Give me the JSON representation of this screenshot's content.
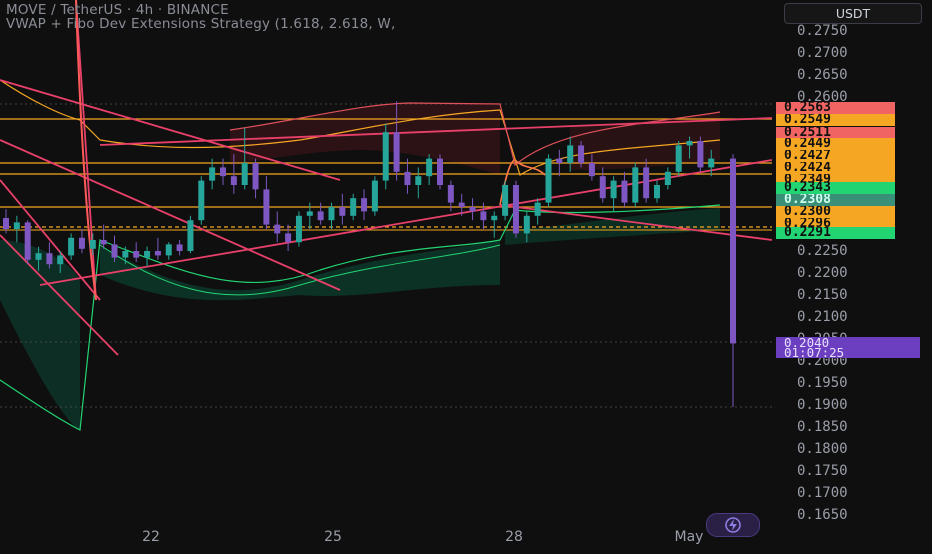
{
  "header": {
    "symbol_line": "MOVE / TetherUS · 4h · BINANCE",
    "indicator_line": "VWAP + Fibo Dev Extensions Strategy (1.618, 2.618, W,"
  },
  "price_axis": {
    "currency_button": "USDT",
    "ticks": [
      "0.2750",
      "0.2700",
      "0.2650",
      "0.2600",
      "0.2550",
      "0.2500",
      "0.2450",
      "0.2400",
      "0.2350",
      "0.2300",
      "0.2250",
      "0.2200",
      "0.2150",
      "0.2100",
      "0.2050",
      "0.2000",
      "0.1950",
      "0.1900",
      "0.1850",
      "0.1800",
      "0.1750",
      "0.1700",
      "0.1650"
    ]
  },
  "level_badges": [
    {
      "label": "0.2563",
      "color": "#f06463"
    },
    {
      "label": "0.2549",
      "color": "#f5a623"
    },
    {
      "label": "0.2511",
      "color": "#f06463"
    },
    {
      "label": "0.2449",
      "color": "#f5a623"
    },
    {
      "label": "0.2427",
      "color": "#f5a623"
    },
    {
      "label": "0.2424",
      "color": "#f5a623"
    },
    {
      "label": "0.2349",
      "color": "#f5a623"
    },
    {
      "label": "0.2343",
      "color": "#22d572"
    },
    {
      "label": "0.2308",
      "color": "#3a8f78"
    },
    {
      "label": "0.2300",
      "color": "#f5a623"
    },
    {
      "label": "0.2296",
      "color": "#f5a623"
    },
    {
      "label": "0.2291",
      "color": "#22d572"
    }
  ],
  "current_price": {
    "price": "0.2040",
    "countdown": "01:07:25",
    "color": "#6b3fbf"
  },
  "time_axis": [
    "22",
    "25",
    "28",
    "May"
  ],
  "chart_data": {
    "type": "candlestick",
    "title": "MOVE / TetherUS · 4h · BINANCE",
    "ylim": [
      0.1635,
      0.2785
    ],
    "x": [
      "22",
      "25",
      "28",
      "May"
    ],
    "series": [
      {
        "name": "candles",
        "values": [
          {
            "o": 0.2325,
            "h": 0.2345,
            "l": 0.229,
            "c": 0.23
          },
          {
            "o": 0.23,
            "h": 0.233,
            "l": 0.227,
            "c": 0.2315
          },
          {
            "o": 0.2315,
            "h": 0.232,
            "l": 0.222,
            "c": 0.223
          },
          {
            "o": 0.223,
            "h": 0.226,
            "l": 0.2205,
            "c": 0.2245
          },
          {
            "o": 0.2245,
            "h": 0.227,
            "l": 0.221,
            "c": 0.222
          },
          {
            "o": 0.222,
            "h": 0.225,
            "l": 0.22,
            "c": 0.224
          },
          {
            "o": 0.224,
            "h": 0.229,
            "l": 0.223,
            "c": 0.228
          },
          {
            "o": 0.228,
            "h": 0.23,
            "l": 0.2245,
            "c": 0.2255
          },
          {
            "o": 0.2255,
            "h": 0.229,
            "l": 0.224,
            "c": 0.2275
          },
          {
            "o": 0.2275,
            "h": 0.231,
            "l": 0.2255,
            "c": 0.2265
          },
          {
            "o": 0.2265,
            "h": 0.2285,
            "l": 0.2225,
            "c": 0.2235
          },
          {
            "o": 0.2235,
            "h": 0.226,
            "l": 0.222,
            "c": 0.225
          },
          {
            "o": 0.225,
            "h": 0.227,
            "l": 0.2225,
            "c": 0.2235
          },
          {
            "o": 0.2235,
            "h": 0.226,
            "l": 0.2215,
            "c": 0.225
          },
          {
            "o": 0.225,
            "h": 0.228,
            "l": 0.223,
            "c": 0.224
          },
          {
            "o": 0.224,
            "h": 0.227,
            "l": 0.223,
            "c": 0.2265
          },
          {
            "o": 0.2265,
            "h": 0.2275,
            "l": 0.224,
            "c": 0.225
          },
          {
            "o": 0.225,
            "h": 0.233,
            "l": 0.2245,
            "c": 0.232
          },
          {
            "o": 0.232,
            "h": 0.242,
            "l": 0.231,
            "c": 0.241
          },
          {
            "o": 0.241,
            "h": 0.246,
            "l": 0.239,
            "c": 0.244
          },
          {
            "o": 0.244,
            "h": 0.246,
            "l": 0.24,
            "c": 0.242
          },
          {
            "o": 0.242,
            "h": 0.247,
            "l": 0.238,
            "c": 0.24
          },
          {
            "o": 0.24,
            "h": 0.253,
            "l": 0.239,
            "c": 0.245
          },
          {
            "o": 0.245,
            "h": 0.246,
            "l": 0.237,
            "c": 0.239
          },
          {
            "o": 0.239,
            "h": 0.242,
            "l": 0.23,
            "c": 0.231
          },
          {
            "o": 0.231,
            "h": 0.234,
            "l": 0.227,
            "c": 0.229
          },
          {
            "o": 0.229,
            "h": 0.231,
            "l": 0.225,
            "c": 0.227
          },
          {
            "o": 0.227,
            "h": 0.234,
            "l": 0.226,
            "c": 0.233
          },
          {
            "o": 0.233,
            "h": 0.236,
            "l": 0.23,
            "c": 0.234
          },
          {
            "o": 0.234,
            "h": 0.236,
            "l": 0.231,
            "c": 0.232
          },
          {
            "o": 0.232,
            "h": 0.236,
            "l": 0.23,
            "c": 0.235
          },
          {
            "o": 0.235,
            "h": 0.238,
            "l": 0.231,
            "c": 0.233
          },
          {
            "o": 0.233,
            "h": 0.238,
            "l": 0.232,
            "c": 0.237
          },
          {
            "o": 0.237,
            "h": 0.239,
            "l": 0.232,
            "c": 0.234
          },
          {
            "o": 0.234,
            "h": 0.242,
            "l": 0.233,
            "c": 0.241
          },
          {
            "o": 0.241,
            "h": 0.254,
            "l": 0.239,
            "c": 0.252
          },
          {
            "o": 0.252,
            "h": 0.259,
            "l": 0.241,
            "c": 0.243
          },
          {
            "o": 0.243,
            "h": 0.246,
            "l": 0.238,
            "c": 0.24
          },
          {
            "o": 0.24,
            "h": 0.244,
            "l": 0.237,
            "c": 0.242
          },
          {
            "o": 0.242,
            "h": 0.247,
            "l": 0.24,
            "c": 0.246
          },
          {
            "o": 0.246,
            "h": 0.247,
            "l": 0.239,
            "c": 0.24
          },
          {
            "o": 0.24,
            "h": 0.241,
            "l": 0.234,
            "c": 0.236
          },
          {
            "o": 0.236,
            "h": 0.238,
            "l": 0.233,
            "c": 0.235
          },
          {
            "o": 0.235,
            "h": 0.237,
            "l": 0.232,
            "c": 0.234
          },
          {
            "o": 0.234,
            "h": 0.236,
            "l": 0.23,
            "c": 0.232
          },
          {
            "o": 0.232,
            "h": 0.234,
            "l": 0.228,
            "c": 0.233
          },
          {
            "o": 0.233,
            "h": 0.241,
            "l": 0.232,
            "c": 0.24
          },
          {
            "o": 0.24,
            "h": 0.241,
            "l": 0.228,
            "c": 0.229
          },
          {
            "o": 0.229,
            "h": 0.234,
            "l": 0.227,
            "c": 0.233
          },
          {
            "o": 0.233,
            "h": 0.237,
            "l": 0.231,
            "c": 0.236
          },
          {
            "o": 0.236,
            "h": 0.247,
            "l": 0.235,
            "c": 0.246
          },
          {
            "o": 0.246,
            "h": 0.248,
            "l": 0.242,
            "c": 0.245
          },
          {
            "o": 0.245,
            "h": 0.251,
            "l": 0.243,
            "c": 0.249
          },
          {
            "o": 0.249,
            "h": 0.25,
            "l": 0.244,
            "c": 0.245
          },
          {
            "o": 0.245,
            "h": 0.247,
            "l": 0.241,
            "c": 0.242
          },
          {
            "o": 0.242,
            "h": 0.244,
            "l": 0.236,
            "c": 0.237
          },
          {
            "o": 0.237,
            "h": 0.242,
            "l": 0.234,
            "c": 0.241
          },
          {
            "o": 0.241,
            "h": 0.243,
            "l": 0.235,
            "c": 0.236
          },
          {
            "o": 0.236,
            "h": 0.245,
            "l": 0.235,
            "c": 0.244
          },
          {
            "o": 0.244,
            "h": 0.246,
            "l": 0.236,
            "c": 0.237
          },
          {
            "o": 0.237,
            "h": 0.241,
            "l": 0.236,
            "c": 0.24
          },
          {
            "o": 0.24,
            "h": 0.244,
            "l": 0.239,
            "c": 0.243
          },
          {
            "o": 0.243,
            "h": 0.25,
            "l": 0.242,
            "c": 0.249
          },
          {
            "o": 0.249,
            "h": 0.251,
            "l": 0.246,
            "c": 0.25
          },
          {
            "o": 0.25,
            "h": 0.251,
            "l": 0.243,
            "c": 0.244
          },
          {
            "o": 0.244,
            "h": 0.248,
            "l": 0.242,
            "c": 0.246
          },
          {
            "o": 0.246,
            "h": 0.247,
            "l": 0.202,
            "c": 0.204
          }
        ]
      }
    ],
    "price_levels": [
      "0.2563",
      "0.2549",
      "0.2511",
      "0.2449",
      "0.2427",
      "0.2424",
      "0.2349",
      "0.2343",
      "0.2308",
      "0.2300",
      "0.2296",
      "0.2291"
    ],
    "current_price": "0.2040",
    "grid": false
  },
  "colors": {
    "bull": "#26a69a",
    "bear": "#7e57c2",
    "last": "#7e57c2",
    "accent": "#f5a623"
  },
  "icons": {
    "bolt": "lightning-icon"
  }
}
